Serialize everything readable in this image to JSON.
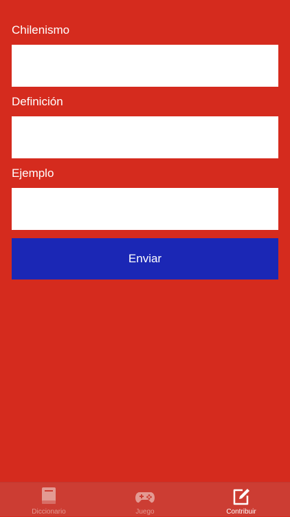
{
  "form": {
    "fields": [
      {
        "label": "Chilenismo",
        "value": "",
        "placeholder": ""
      },
      {
        "label": "Definición",
        "value": "",
        "placeholder": ""
      },
      {
        "label": "Ejemplo",
        "value": "",
        "placeholder": ""
      }
    ],
    "submit_label": "Enviar"
  },
  "tabbar": {
    "tabs": [
      {
        "label": "Diccionario",
        "icon": "book-icon",
        "selected": false
      },
      {
        "label": "Juego",
        "icon": "gamepad-icon",
        "selected": false
      },
      {
        "label": "Contribuir",
        "icon": "compose-icon",
        "selected": true
      }
    ]
  },
  "colors": {
    "background": "#D52B1E",
    "submit_button": "#1B27B5",
    "tabbar": "#CC3D33",
    "tab_active": "#FFFFFF",
    "tab_inactive": "#E39A93"
  }
}
